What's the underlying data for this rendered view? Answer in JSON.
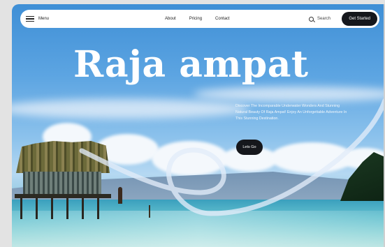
{
  "nav": {
    "menu_label": "Menu",
    "links": [
      "About",
      "Pricing",
      "Contact"
    ],
    "search_label": "Search",
    "cta_label": "Get Started"
  },
  "hero": {
    "title": "Raja ampat",
    "description": "Discover The Incomparable Underwater Wonders And Stunning Natural Beauty Of Raja Ampat! Enjoy An Unforgettable Adventure In This Stunning Destination.",
    "button_label": "Lets Go"
  },
  "colors": {
    "accent_dark": "#15171c",
    "sky": "#5da5e2",
    "sea": "#62c0cf",
    "text_light": "#ffffff"
  },
  "icons": [
    "hamburger-icon",
    "search-icon"
  ]
}
